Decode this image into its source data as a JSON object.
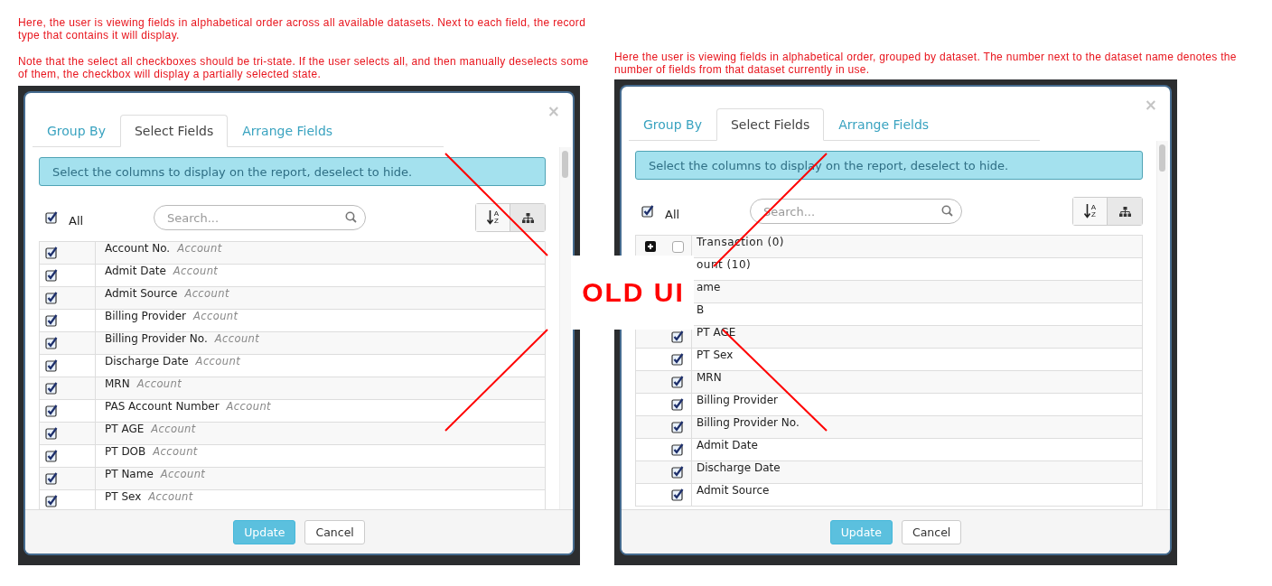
{
  "notes_left": [
    "Here, the user is viewing fields in alphabetical order across all available datasets. Next to each field, the record type that contains it will display.",
    "Note that the select all checkboxes should be tri-state. If the user selects all, and then manually deselects some of them, the checkbox will display a partially selected state."
  ],
  "notes_right": [
    "Here the user is viewing fields in alphabetical order, grouped by dataset. The number next to the dataset name denotes the number of fields from that dataset currently in use."
  ],
  "dialogs": [
    {
      "kind": "flat",
      "close": "×",
      "tabs": [
        {
          "label": "Group By",
          "selected": false
        },
        {
          "label": "Select Fields",
          "selected": true
        },
        {
          "label": "Arrange Fields",
          "selected": false
        }
      ],
      "info": "Select the columns to display on the report, deselect to hide.",
      "select_all": {
        "label": "All",
        "checked": true
      },
      "search": {
        "placeholder": "Search..."
      },
      "sort_letters": [
        "A",
        "Z"
      ],
      "rows": [
        {
          "kind": "field",
          "label": "Account No.",
          "dataset": "Account",
          "checked": true
        },
        {
          "kind": "field",
          "label": "Admit Date",
          "dataset": "Account",
          "checked": true
        },
        {
          "kind": "field",
          "label": "Admit Source",
          "dataset": "Account",
          "checked": true
        },
        {
          "kind": "field",
          "label": "Billing Provider",
          "dataset": "Account",
          "checked": true
        },
        {
          "kind": "field",
          "label": "Billing Provider No.",
          "dataset": "Account",
          "checked": true
        },
        {
          "kind": "field",
          "label": "Discharge Date",
          "dataset": "Account",
          "checked": true
        },
        {
          "kind": "field",
          "label": "MRN",
          "dataset": "Account",
          "checked": true
        },
        {
          "kind": "field",
          "label": "PAS Account Number",
          "dataset": "Account",
          "checked": true
        },
        {
          "kind": "field",
          "label": "PT AGE",
          "dataset": "Account",
          "checked": true
        },
        {
          "kind": "field",
          "label": "PT DOB",
          "dataset": "Account",
          "checked": true
        },
        {
          "kind": "field",
          "label": "PT Name",
          "dataset": "Account",
          "checked": true
        },
        {
          "kind": "field",
          "label": "PT Sex",
          "dataset": "Account",
          "checked": true
        }
      ],
      "buttons": [
        {
          "label": "Update",
          "kind": "primary"
        },
        {
          "label": "Cancel",
          "kind": "default"
        }
      ]
    },
    {
      "kind": "grouped",
      "close": "×",
      "tabs": [
        {
          "label": "Group By",
          "selected": false
        },
        {
          "label": "Select Fields",
          "selected": true
        },
        {
          "label": "Arrange Fields",
          "selected": false
        }
      ],
      "info": "Select the columns to display on the report, deselect to hide.",
      "select_all": {
        "label": "All",
        "checked": true
      },
      "search": {
        "placeholder": "Search..."
      },
      "sort_letters": [
        "A",
        "Z"
      ],
      "rows": [
        {
          "kind": "group",
          "label": "Transaction (0)",
          "expanded": false,
          "checked": false
        },
        {
          "kind": "group",
          "label": "ount (10)"
        },
        {
          "kind": "field",
          "label": "ame"
        },
        {
          "kind": "field",
          "label": "B"
        },
        {
          "kind": "field",
          "label": "PT AGE",
          "checked": true
        },
        {
          "kind": "field",
          "label": "PT Sex",
          "checked": true
        },
        {
          "kind": "field",
          "label": "MRN",
          "checked": true
        },
        {
          "kind": "field",
          "label": "Billing Provider",
          "checked": true
        },
        {
          "kind": "field",
          "label": "Billing Provider No.",
          "checked": true
        },
        {
          "kind": "field",
          "label": "Admit Date",
          "checked": true
        },
        {
          "kind": "field",
          "label": "Discharge Date",
          "checked": true
        },
        {
          "kind": "field",
          "label": "Admit Source",
          "checked": true
        }
      ],
      "buttons": [
        {
          "label": "Update",
          "kind": "primary"
        },
        {
          "label": "Cancel",
          "kind": "default"
        }
      ]
    }
  ],
  "stamp": "OLD UI"
}
